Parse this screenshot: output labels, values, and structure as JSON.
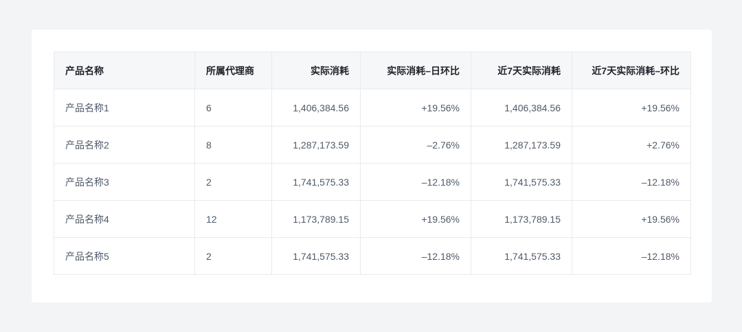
{
  "table": {
    "headers": [
      "产品名称",
      "所属代理商",
      "实际消耗",
      "实际消耗–日环比",
      "近7天实际消耗",
      "近7天实际消耗–环比"
    ],
    "rows": [
      {
        "name": "产品名称1",
        "agents": "6",
        "consumption": "1,406,384.56",
        "daily_change": "+19.56%",
        "daily_trend": "up",
        "week_consumption": "1,406,384.56",
        "week_change": "+19.56%",
        "week_trend": "up"
      },
      {
        "name": "产品名称2",
        "agents": "8",
        "consumption": "1,287,173.59",
        "daily_change": "–2.76%",
        "daily_trend": "down",
        "week_consumption": "1,287,173.59",
        "week_change": "+2.76%",
        "week_trend": "up"
      },
      {
        "name": "产品名称3",
        "agents": "2",
        "consumption": "1,741,575.33",
        "daily_change": "–12.18%",
        "daily_trend": "down",
        "week_consumption": "1,741,575.33",
        "week_change": "–12.18%",
        "week_trend": "down"
      },
      {
        "name": "产品名称4",
        "agents": "12",
        "consumption": "1,173,789.15",
        "daily_change": "+19.56%",
        "daily_trend": "up",
        "week_consumption": "1,173,789.15",
        "week_change": "+19.56%",
        "week_trend": "up"
      },
      {
        "name": "产品名称5",
        "agents": "2",
        "consumption": "1,741,575.33",
        "daily_change": "–12.18%",
        "daily_trend": "down",
        "week_consumption": "1,741,575.33",
        "week_change": "–12.18%",
        "week_trend": "down"
      }
    ]
  },
  "colors": {
    "page_background": "#f3f4f6",
    "card_background": "#ffffff",
    "header_background": "#f6f7f9",
    "border": "#e8eaee",
    "link": "#1677ff",
    "increase": "#f5483b",
    "decrease": "#23b266"
  }
}
